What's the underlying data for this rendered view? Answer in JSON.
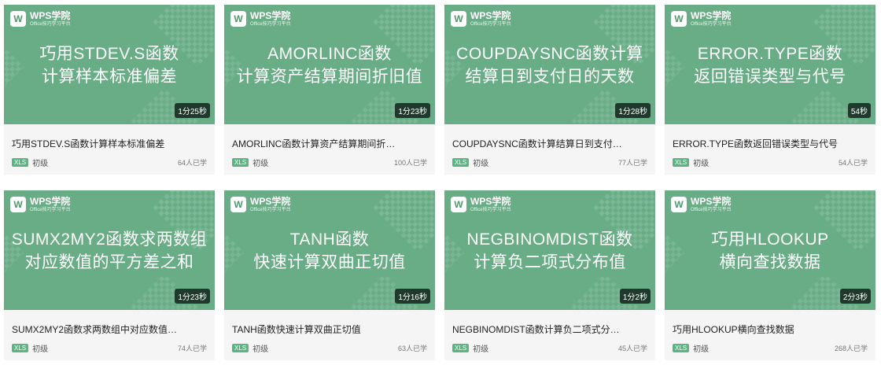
{
  "brand": {
    "name": "WPS学院",
    "subtitle": "Office技巧学习平台"
  },
  "courses": [
    {
      "thumb_line1": "巧用STDEV.S函数",
      "thumb_line2": "计算样本标准偏差",
      "duration": "1分25秒",
      "title": "巧用STDEV.S函数计算样本标准偏差",
      "badge": "XLS",
      "level": "初级",
      "learners": "64人已学"
    },
    {
      "thumb_line1": "AMORLINC函数",
      "thumb_line2": "计算资产结算期间折旧值",
      "duration": "1分23秒",
      "title": "AMORLINC函数计算资产结算期间折…",
      "badge": "XLS",
      "level": "初级",
      "learners": "100人已学"
    },
    {
      "thumb_line1": "COUPDAYSNC函数计算",
      "thumb_line2": "结算日到支付日的天数",
      "duration": "1分28秒",
      "title": "COUPDAYSNC函数计算结算日到支付…",
      "badge": "XLS",
      "level": "初级",
      "learners": "77人已学"
    },
    {
      "thumb_line1": "ERROR.TYPE函数",
      "thumb_line2": "返回错误类型与代号",
      "duration": "54秒",
      "title": "ERROR.TYPE函数返回错误类型与代号",
      "badge": "XLS",
      "level": "初级",
      "learners": "54人已学"
    },
    {
      "thumb_line1": "SUMX2MY2函数求两数组",
      "thumb_line2": "对应数值的平方差之和",
      "duration": "1分23秒",
      "title": "SUMX2MY2函数求两数组中对应数值…",
      "badge": "XLS",
      "level": "初级",
      "learners": "74人已学"
    },
    {
      "thumb_line1": "TANH函数",
      "thumb_line2": "快速计算双曲正切值",
      "duration": "1分16秒",
      "title": "TANH函数快速计算双曲正切值",
      "badge": "XLS",
      "level": "初级",
      "learners": "63人已学"
    },
    {
      "thumb_line1": "NEGBINOMDIST函数",
      "thumb_line2": "计算负二项式分布值",
      "duration": "1分2秒",
      "title": "NEGBINOMDIST函数计算负二项式分…",
      "badge": "XLS",
      "level": "初级",
      "learners": "45人已学"
    },
    {
      "thumb_line1": "巧用HLOOKUP",
      "thumb_line2": "横向查找数据",
      "duration": "2分3秒",
      "title": "巧用HLOOKUP横向查找数据",
      "badge": "XLS",
      "level": "初级",
      "learners": "268人已学"
    }
  ],
  "colors": {
    "thumb_bg": "#69ad86",
    "badge_bg": "#5cb483",
    "duration_bg": "#1f3a2c"
  }
}
